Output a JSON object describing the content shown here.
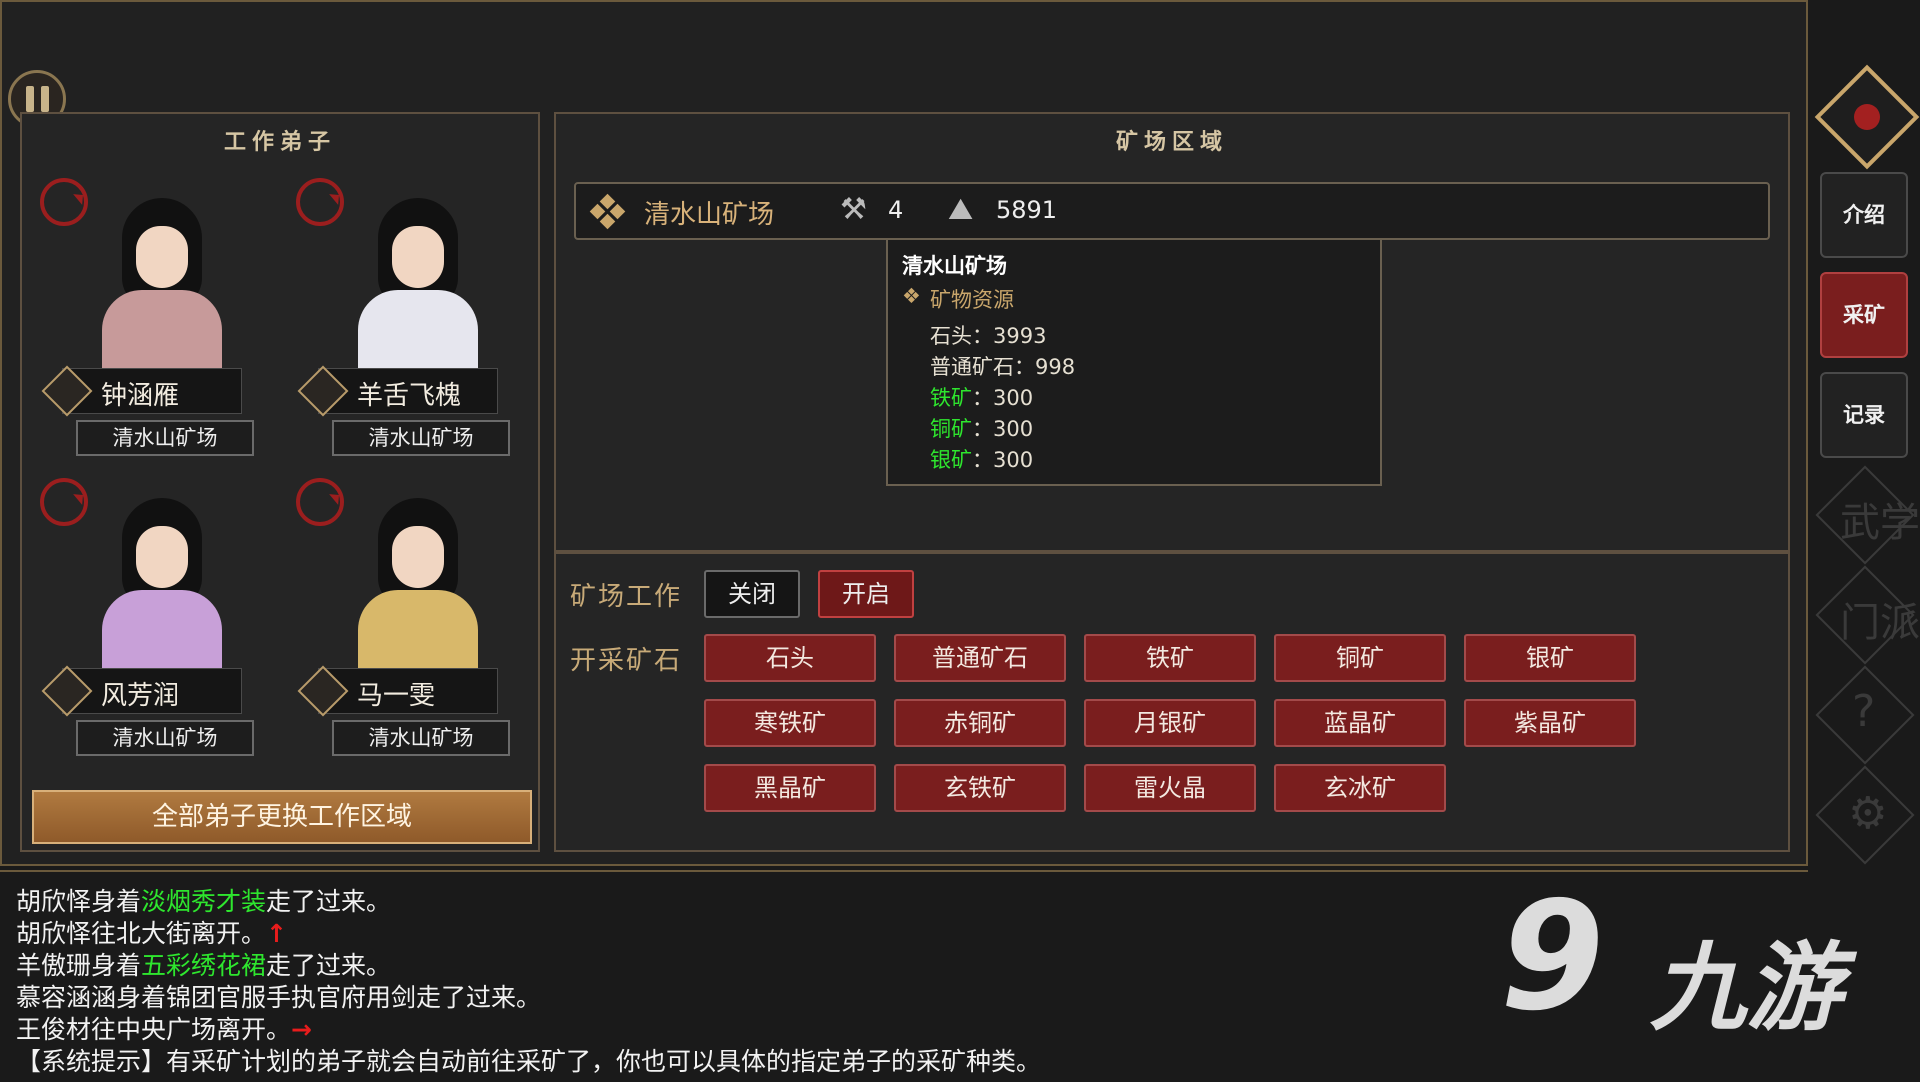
{
  "left_panel": {
    "title": "工作弟子",
    "disciples": [
      {
        "name": "钟涵雁",
        "location": "清水山矿场"
      },
      {
        "name": "羊舌飞槐",
        "location": "清水山矿场"
      },
      {
        "name": "风芳润",
        "location": "清水山矿场"
      },
      {
        "name": "马一雯",
        "location": "清水山矿场"
      }
    ],
    "change_all_label": "全部弟子更换工作区域"
  },
  "mine_panel": {
    "title": "矿场区域",
    "mine_name": "清水山矿场",
    "workers": "4",
    "ore_total": "5891",
    "tooltip": {
      "title": "清水山矿场",
      "section": "矿物资源",
      "items": [
        {
          "label": "石头",
          "sep": "：",
          "value": "3993",
          "color": "#f2f2f2"
        },
        {
          "label": "普通矿石",
          "sep": "：",
          "value": "998",
          "color": "#f2f2f2"
        },
        {
          "label": "铁矿",
          "sep": "：",
          "value": "300",
          "color": "#2ee62e"
        },
        {
          "label": "铜矿",
          "sep": "：",
          "value": "300",
          "color": "#2ee62e"
        },
        {
          "label": "银矿",
          "sep": "：",
          "value": "300",
          "color": "#2ee62e"
        }
      ]
    }
  },
  "work_panel": {
    "work_label": "矿场工作",
    "off_label": "关闭",
    "on_label": "开启",
    "ore_label": "开采矿石",
    "ores": [
      "石头",
      "普通矿石",
      "铁矿",
      "铜矿",
      "银矿",
      "寒铁矿",
      "赤铜矿",
      "月银矿",
      "蓝晶矿",
      "紫晶矿",
      "黑晶矿",
      "玄铁矿",
      "雷火晶",
      "玄冰矿"
    ]
  },
  "sidebar": {
    "intro": "介绍",
    "mining": "采矿",
    "records": "记录",
    "faded1": "武学",
    "faded2": "门派",
    "help": "?",
    "gear": "settings"
  },
  "log": [
    {
      "pre": "胡欣怿身着",
      "hl": "淡烟秀才装",
      "post": "走了过来。",
      "arrow": ""
    },
    {
      "pre": "胡欣怿往北大街离开。",
      "hl": "",
      "post": "",
      "arrow": "↑"
    },
    {
      "pre": "羊傲珊身着",
      "hl": "五彩绣花裙",
      "post": "走了过来。",
      "arrow": ""
    },
    {
      "pre": "慕容涵涵身着锦团官服手执官府用剑走了过来。",
      "hl": "",
      "post": "",
      "arrow": ""
    },
    {
      "pre": "王俊材往中央广场离开。",
      "hl": "",
      "post": "",
      "arrow": "→"
    },
    {
      "pre": "【系统提示】有采矿计划的弟子就会自动前往采矿了，你也可以具体的指定弟子的采矿种类。",
      "hl": "",
      "post": "",
      "arrow": ""
    }
  ],
  "watermark": {
    "logo": "9",
    "text": "九游"
  },
  "colors": {
    "accent_red": "#7a1e1e",
    "gold": "#c9a66b",
    "green_text": "#2ee62e"
  }
}
